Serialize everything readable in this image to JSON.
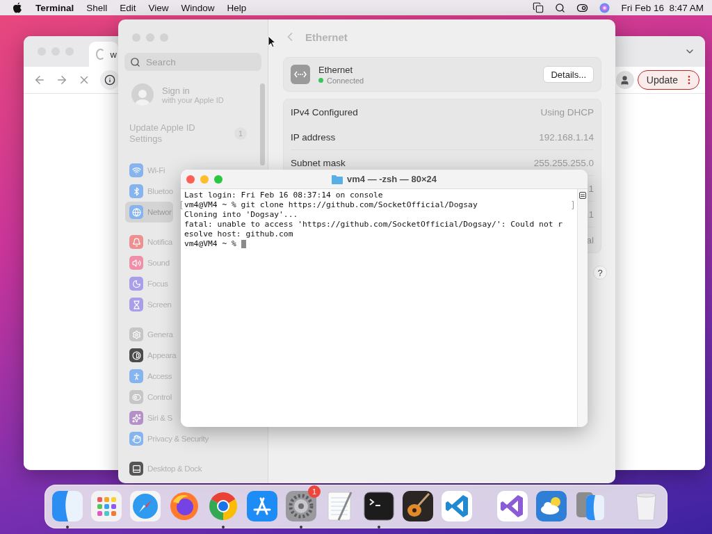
{
  "menu_bar": {
    "app_name": "Terminal",
    "menus": [
      "Shell",
      "Edit",
      "View",
      "Window",
      "Help"
    ],
    "clock": "Fri Feb 16  8:47 AM"
  },
  "browser": {
    "tab_title": "w",
    "update_button": "Update"
  },
  "settings": {
    "search": {
      "placeholder": "Search"
    },
    "account": {
      "title": "Sign in",
      "subtitle": "with your Apple ID"
    },
    "notice": {
      "text": "Update Apple ID Settings",
      "badge": "1"
    },
    "groups": [
      {
        "items": [
          {
            "label": "Wi-Fi",
            "kind": "wifi",
            "color": "#86b4ee",
            "selected": false
          },
          {
            "label": "Bluetoo",
            "kind": "bluetooth",
            "color": "#86b4ee",
            "selected": false
          },
          {
            "label": "Networ",
            "kind": "globe",
            "color": "#86b4ee",
            "selected": true
          }
        ]
      },
      {
        "items": [
          {
            "label": "Notifica",
            "kind": "bell",
            "color": "#ee9090",
            "selected": false
          },
          {
            "label": "Sound",
            "kind": "speaker",
            "color": "#ef90a8",
            "selected": false
          },
          {
            "label": "Focus",
            "kind": "moon",
            "color": "#a99ee8",
            "selected": false
          },
          {
            "label": "Screen",
            "kind": "hourglass",
            "color": "#a99ee8",
            "selected": false
          }
        ]
      },
      {
        "items": [
          {
            "label": "Genera",
            "kind": "gear",
            "color": "#c6c6c6",
            "selected": false
          },
          {
            "label": "Appeara",
            "kind": "contrast",
            "color": "#4c4c4c",
            "selected": false
          },
          {
            "label": "Access",
            "kind": "person",
            "color": "#86b4ee",
            "selected": false
          },
          {
            "label": "Control",
            "kind": "toggles",
            "color": "#c6c6c6",
            "selected": false
          },
          {
            "label": "Siri & S",
            "kind": "orb",
            "color": "#b590c8",
            "selected": false
          },
          {
            "label": "Privacy & Security",
            "kind": "hand",
            "color": "#86b4ee",
            "selected": false
          }
        ]
      },
      {
        "items": [
          {
            "label": "Desktop & Dock",
            "kind": "dock",
            "color": "#565656",
            "selected": false
          }
        ]
      }
    ],
    "pane": {
      "title": "Ethernet",
      "device": {
        "name": "Ethernet",
        "status": "Connected",
        "connected": true,
        "button": "Details..."
      },
      "rows": [
        {
          "label": "IPv4 Configured",
          "value": "Using DHCP"
        },
        {
          "label": "IP address",
          "value": "192.168.1.14"
        },
        {
          "label": "Subnet mask",
          "value": "255.255.255.0"
        },
        {
          "value": ".1"
        },
        {
          "value": ".1"
        },
        {
          "value": "al"
        }
      ],
      "help_button": "?"
    }
  },
  "terminal": {
    "title": "vm4 — -zsh — 80×24",
    "cursor": true,
    "lines": [
      {
        "text": "Last login: Fri Feb 16 08:37:14 on console",
        "marked": false
      },
      {
        "text": "vm4@VM4 ~ % git clone https://github.com/SocketOfficial/Dogsay",
        "marked": true
      },
      {
        "text": "Cloning into 'Dogsay'...",
        "marked": false
      },
      {
        "text": "fatal: unable to access 'https://github.com/SocketOfficial/Dogsay/': Could not r",
        "marked": false
      },
      {
        "text": "esolve host: github.com",
        "marked": false
      },
      {
        "text": "vm4@VM4 ~ % ",
        "marked": false
      }
    ]
  },
  "dock": {
    "sections": [
      {
        "apps": [
          {
            "kind": "finder",
            "running": true
          },
          {
            "kind": "launchpad",
            "running": false
          },
          {
            "kind": "safari",
            "running": false
          },
          {
            "kind": "firefox",
            "running": false
          },
          {
            "kind": "chrome",
            "running": true
          },
          {
            "kind": "appstore",
            "running": false
          },
          {
            "kind": "settings",
            "running": true,
            "badge": "1"
          },
          {
            "kind": "textedit",
            "running": false
          },
          {
            "kind": "terminal",
            "running": true
          },
          {
            "kind": "garageband",
            "running": false
          },
          {
            "kind": "vscode",
            "running": false
          }
        ]
      },
      {
        "apps": [
          {
            "kind": "visualstudio",
            "running": false
          },
          {
            "kind": "weather",
            "running": false
          },
          {
            "kind": "migration",
            "running": false
          }
        ]
      },
      {
        "apps": [
          {
            "kind": "trash",
            "running": false
          }
        ]
      }
    ]
  }
}
